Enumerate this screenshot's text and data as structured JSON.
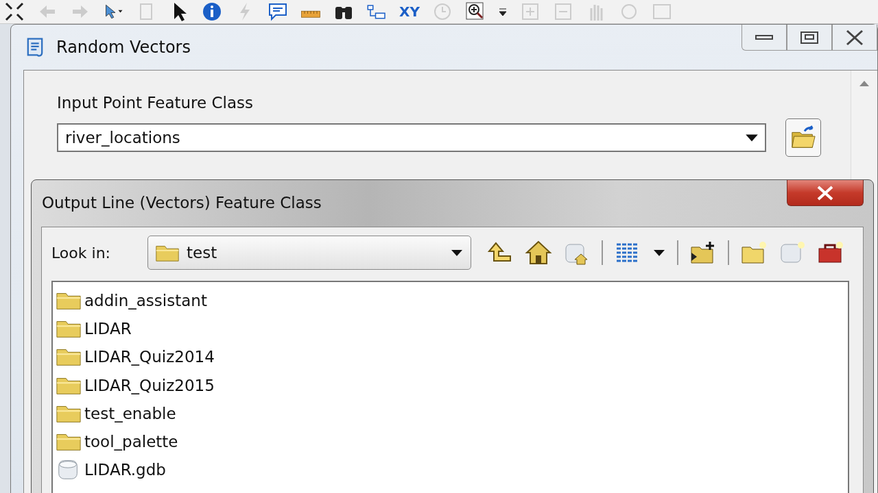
{
  "toolbar": {
    "xy_label": "XY"
  },
  "window": {
    "title": "Random Vectors"
  },
  "form": {
    "input_label": "Input Point Feature Class",
    "input_value": "river_locations"
  },
  "dialog": {
    "title": "Output Line (Vectors) Feature Class",
    "look_in_label": "Look in:",
    "look_in_value": "test",
    "items": [
      {
        "name": "addin_assistant",
        "kind": "folder"
      },
      {
        "name": "LIDAR",
        "kind": "folder"
      },
      {
        "name": "LIDAR_Quiz2014",
        "kind": "folder"
      },
      {
        "name": "LIDAR_Quiz2015",
        "kind": "folder"
      },
      {
        "name": "test_enable",
        "kind": "folder"
      },
      {
        "name": "tool_palette",
        "kind": "folder"
      },
      {
        "name": "LIDAR.gdb",
        "kind": "gdb"
      }
    ]
  }
}
